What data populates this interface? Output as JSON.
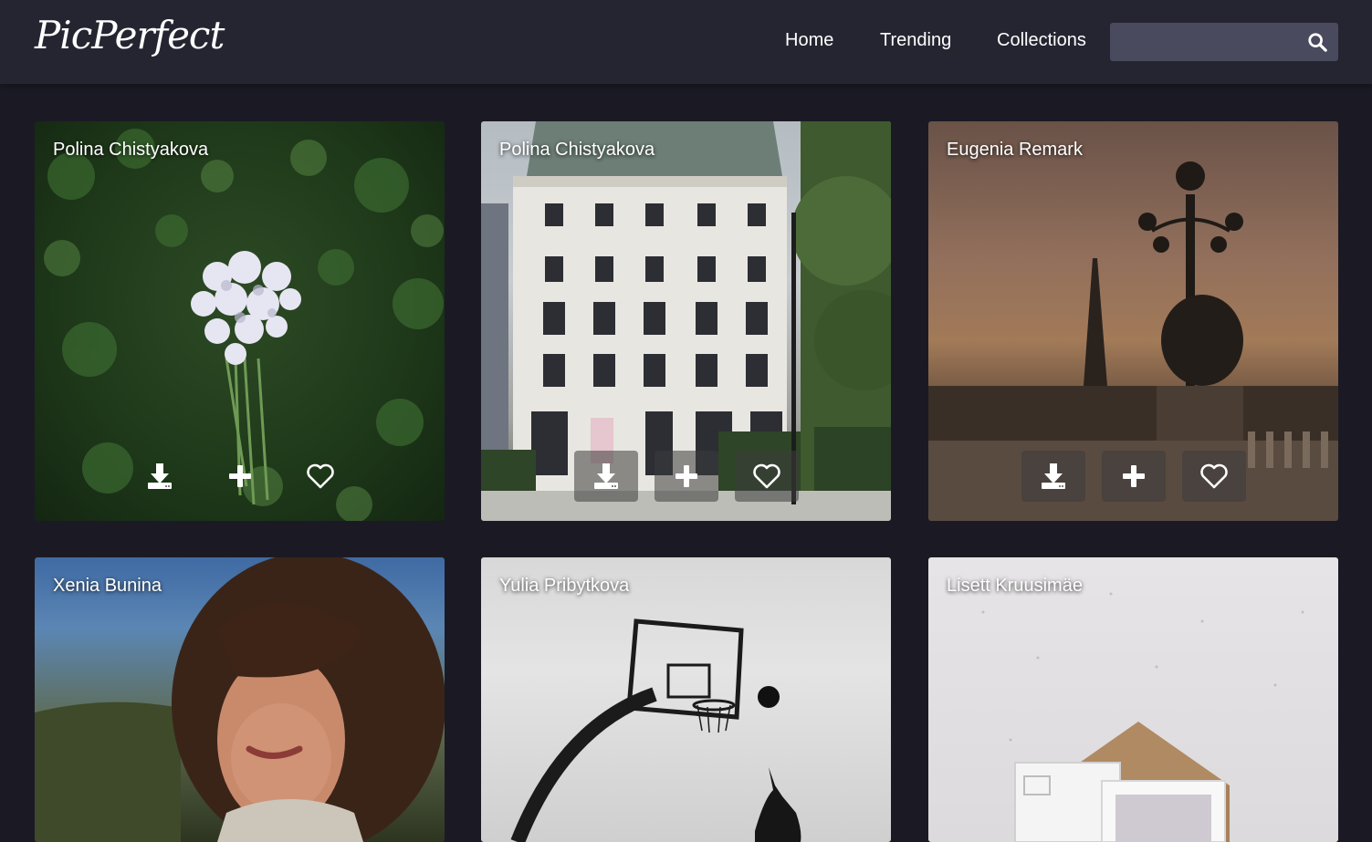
{
  "app": {
    "logo": "PicPerfect"
  },
  "nav": {
    "home": "Home",
    "trending": "Trending",
    "collections": "Collections"
  },
  "search": {
    "placeholder": "",
    "value": ""
  },
  "photos": [
    {
      "author": "Polina Chistyakova"
    },
    {
      "author": "Polina Chistyakova"
    },
    {
      "author": "Eugenia Remark"
    },
    {
      "author": "Xenia Bunina"
    },
    {
      "author": "Yulia Pribytkova"
    },
    {
      "author": "Lisett Kruusimäe"
    }
  ],
  "actions": {
    "download": "download-icon",
    "add": "plus-icon",
    "like": "heart-icon"
  },
  "colors": {
    "background": "#1b1a24",
    "header": "#252532",
    "search": "#494a5e"
  }
}
